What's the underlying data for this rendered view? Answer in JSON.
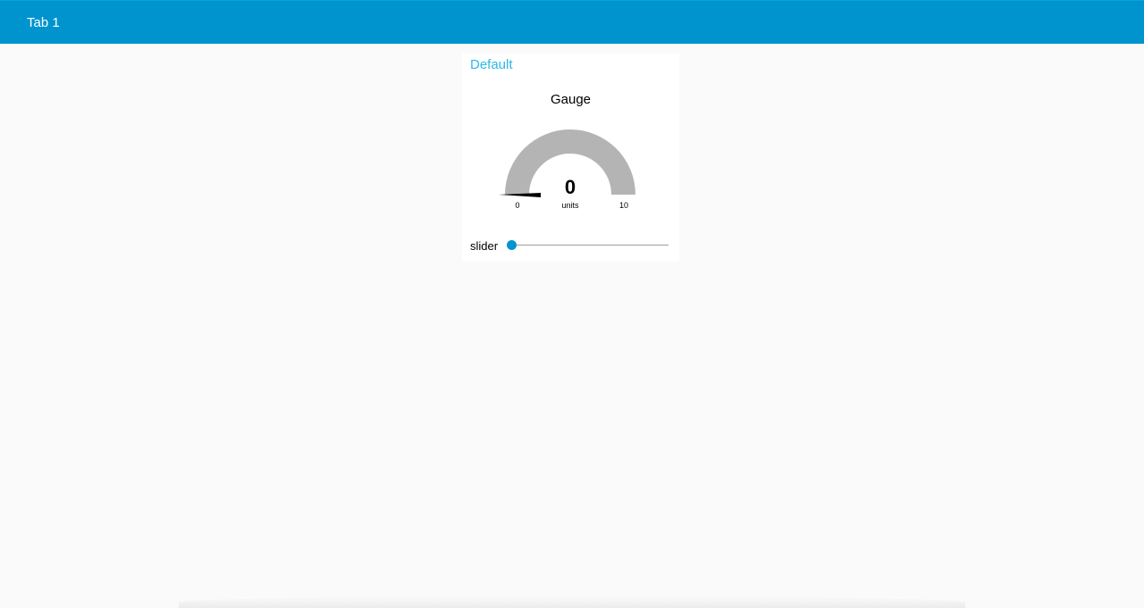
{
  "header": {
    "title": "Tab 1"
  },
  "group": {
    "title": "Default"
  },
  "gauge": {
    "title": "Gauge",
    "value": "0",
    "units": "units",
    "min": "0",
    "max": "10",
    "fraction": 0,
    "arc_color": "#b4b4b4",
    "needle_color": "#000000"
  },
  "slider": {
    "label": "slider",
    "value": 0,
    "thumb_color": "#0094ce"
  },
  "colors": {
    "topbar": "#0094ce",
    "group_title": "#2bb8e6",
    "background": "#fafafa"
  }
}
